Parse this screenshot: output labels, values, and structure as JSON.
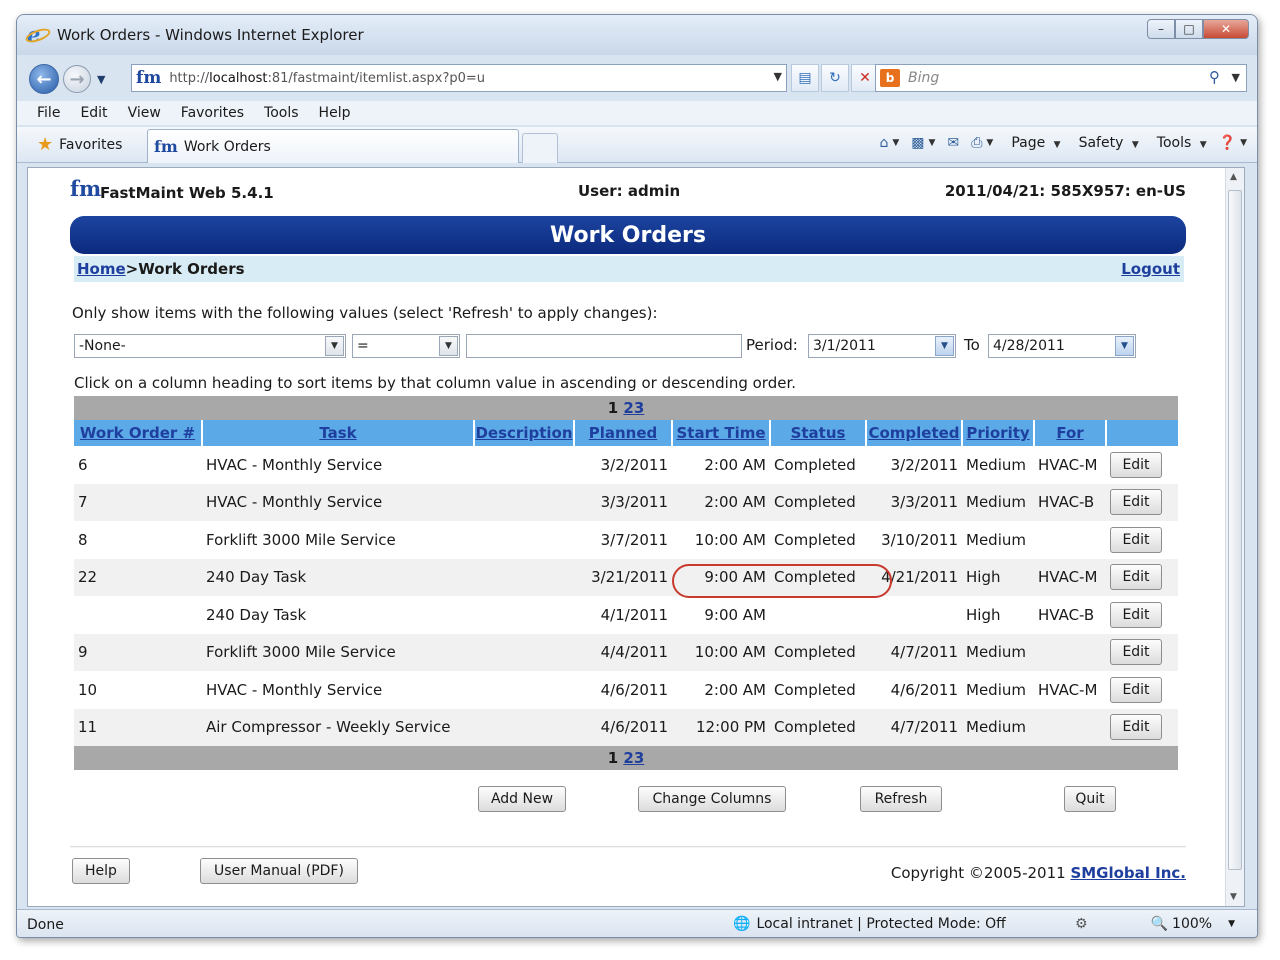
{
  "window": {
    "title": "Work Orders - Windows Internet Explorer",
    "controls": {
      "minimize": "–",
      "maximize": "□",
      "close": "✕"
    }
  },
  "address_bar": {
    "url_prefix": "http://",
    "url_host": "localhost",
    "url_path": ":81/fastmaint/itemlist.aspx?p0=u",
    "search_placeholder": "Bing"
  },
  "menu": [
    "File",
    "Edit",
    "View",
    "Favorites",
    "Tools",
    "Help"
  ],
  "favorites_bar": {
    "favorites_label": "Favorites",
    "tab_label": "Work Orders",
    "commands": {
      "page": "Page",
      "safety": "Safety",
      "tools": "Tools"
    }
  },
  "app": {
    "logo_text": "fm",
    "name": "FastMaint Web 5.4.1",
    "user": "User: admin",
    "date_info": "2011/04/21: 585X957: en-US",
    "banner_title": "Work Orders",
    "breadcrumb_home": "Home",
    "breadcrumb_sep": ">",
    "breadcrumb_current": "Work Orders",
    "logout": "Logout"
  },
  "filter": {
    "instruction": "Only show items with the following values (select 'Refresh' to apply changes):",
    "field_value": "-None-",
    "operator_value": "=",
    "text_value": "",
    "period_label": "Period:",
    "period_from": "3/1/2011",
    "to_label": "To",
    "period_to": "4/28/2011",
    "sort_instruction": "Click on a column heading to sort items by that column value in ascending or descending order."
  },
  "pager": {
    "current": "1",
    "pages": [
      "2",
      "3"
    ]
  },
  "table": {
    "headers": [
      "Work Order #",
      "Task",
      "Description",
      "Planned",
      "Start Time",
      "Status",
      "Completed",
      "Priority",
      "For",
      ""
    ],
    "edit_label": "Edit",
    "rows": [
      {
        "wo": "6",
        "task": "HVAC - Monthly Service",
        "desc": "",
        "planned": "3/2/2011",
        "start": "2:00 AM",
        "status": "Completed",
        "completed": "3/2/2011",
        "priority": "Medium",
        "for": "HVAC-M"
      },
      {
        "wo": "7",
        "task": "HVAC - Monthly Service",
        "desc": "",
        "planned": "3/3/2011",
        "start": "2:00 AM",
        "status": "Completed",
        "completed": "3/3/2011",
        "priority": "Medium",
        "for": "HVAC-B"
      },
      {
        "wo": "8",
        "task": "Forklift 3000 Mile Service",
        "desc": "",
        "planned": "3/7/2011",
        "start": "10:00 AM",
        "status": "Completed",
        "completed": "3/10/2011",
        "priority": "Medium",
        "for": ""
      },
      {
        "wo": "22",
        "task": "240 Day Task",
        "desc": "",
        "planned": "3/21/2011",
        "start": "9:00 AM",
        "status": "Completed",
        "completed": "4/21/2011",
        "priority": "High",
        "for": "HVAC-M"
      },
      {
        "wo": "",
        "task": "240 Day Task",
        "desc": "",
        "planned": "4/1/2011",
        "start": "9:00 AM",
        "status": "",
        "completed": "",
        "priority": "High",
        "for": "HVAC-B"
      },
      {
        "wo": "9",
        "task": "Forklift 3000 Mile Service",
        "desc": "",
        "planned": "4/4/2011",
        "start": "10:00 AM",
        "status": "Completed",
        "completed": "4/7/2011",
        "priority": "Medium",
        "for": ""
      },
      {
        "wo": "10",
        "task": "HVAC - Monthly Service",
        "desc": "",
        "planned": "4/6/2011",
        "start": "2:00 AM",
        "status": "Completed",
        "completed": "4/6/2011",
        "priority": "Medium",
        "for": "HVAC-M"
      },
      {
        "wo": "11",
        "task": "Air Compressor - Weekly Service",
        "desc": "",
        "planned": "4/6/2011",
        "start": "12:00 PM",
        "status": "Completed",
        "completed": "4/7/2011",
        "priority": "Medium",
        "for": ""
      }
    ]
  },
  "actions": {
    "add_new": "Add New",
    "change_columns": "Change Columns",
    "refresh": "Refresh",
    "quit": "Quit"
  },
  "footer": {
    "help": "Help",
    "user_manual": "User Manual (PDF)",
    "copyright_text": "Copyright ©2005-2011 ",
    "copyright_link": "SMGlobal Inc."
  },
  "statusbar": {
    "status": "Done",
    "zone": "Local intranet | Protected Mode: Off",
    "zoom": "100%"
  },
  "colors": {
    "banner": "#0c2a7e",
    "header": "#5ca9e8",
    "link": "#1f3f9e",
    "highlight": "#c83a2e"
  }
}
